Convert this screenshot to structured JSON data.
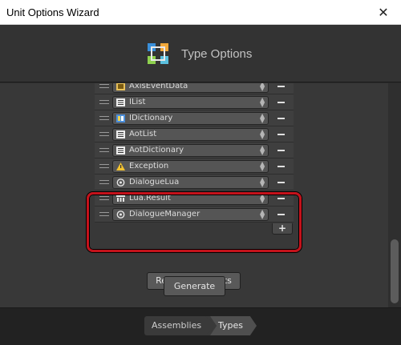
{
  "window": {
    "title": "Unit Options Wizard",
    "close_glyph": "✕"
  },
  "header": {
    "title": "Type Options",
    "logo_icon": "unit-options-logo-icon"
  },
  "types_list": {
    "rows": [
      {
        "label": "AxisEventData",
        "icon": "class-icon"
      },
      {
        "label": "IList",
        "icon": "list-icon"
      },
      {
        "label": "IDictionary",
        "icon": "dictionary-icon"
      },
      {
        "label": "AotList",
        "icon": "list-icon"
      },
      {
        "label": "AotDictionary",
        "icon": "list-icon"
      },
      {
        "label": "Exception",
        "icon": "exception-icon"
      },
      {
        "label": "DialogueLua",
        "icon": "script-icon"
      },
      {
        "label": "Lua.Result",
        "icon": "struct-icon"
      },
      {
        "label": "DialogueManager",
        "icon": "script-icon"
      }
    ],
    "add_label": "+",
    "remove_icon": "minus-icon"
  },
  "actions": {
    "reset_label": "Reset to Defaults",
    "generate_label": "Generate"
  },
  "footer": {
    "steps": [
      "Assemblies",
      "Types"
    ]
  },
  "colors": {
    "highlight": "#c4121b",
    "background": "#383838"
  }
}
